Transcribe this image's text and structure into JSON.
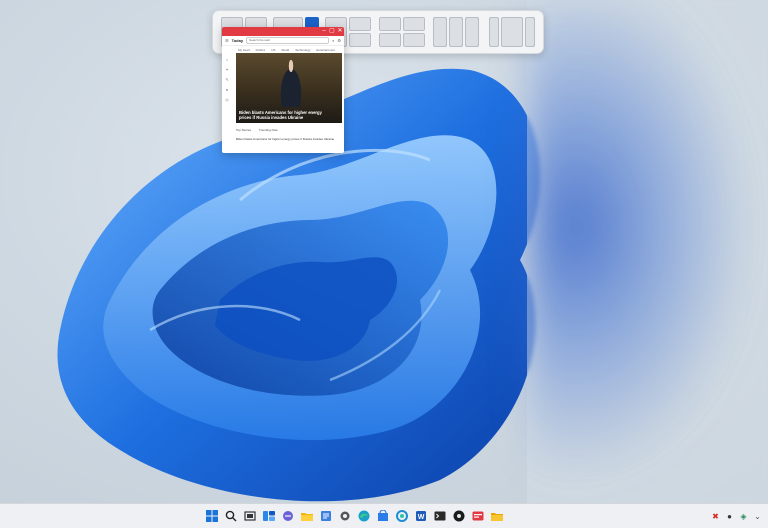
{
  "colors": {
    "accent": "#1a63c9",
    "titlebar": "#e23a43",
    "taskbar": "#eef0f3"
  },
  "snap_flyout": {
    "active_layout": 2,
    "active_zone": 1
  },
  "browser": {
    "brand": "Today",
    "search_placeholder": "Search the web",
    "nav": [
      "My Feed",
      "Politics",
      "US",
      "World",
      "Technology",
      "Entertainment"
    ],
    "hero_headline": "Biden blasts Americans for higher energy prices if Russia invades Ukraine",
    "tabs": [
      "Top Stories",
      "Trending Now"
    ],
    "story_headline": "Biden blasts Americans for higher energy prices if Russia invades Ukraine"
  },
  "taskbar": {
    "icons": [
      "windows-start",
      "search",
      "task-view",
      "widgets",
      "chat",
      "file-explorer",
      "notepad",
      "settings",
      "edge",
      "store",
      "photos",
      "word",
      "terminal",
      "media",
      "news",
      "folder"
    ],
    "tray_icons": [
      "red-x",
      "circle",
      "security",
      "chevron"
    ]
  }
}
